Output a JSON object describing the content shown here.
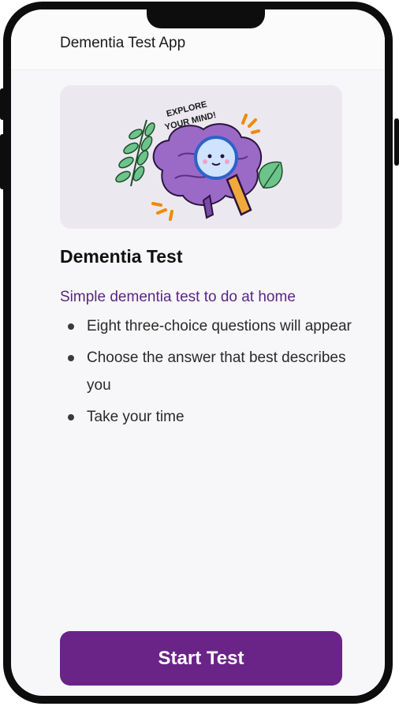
{
  "header": {
    "title": "Dementia Test App"
  },
  "banner": {
    "text_line1": "EXPLORE",
    "text_line2": "YOUR MIND!",
    "icon": "brain-magnifier-illustration"
  },
  "main": {
    "title": "Dementia Test",
    "subtitle": "Simple dementia test to do at home",
    "bullets": [
      "Eight three-choice questions will appear",
      "Choose the answer that best describes you",
      "Take your time"
    ]
  },
  "footer": {
    "start_label": "Start Test"
  },
  "colors": {
    "accent": "#6a2488",
    "subtitle": "#5b2585",
    "banner_bg": "#ece8f0"
  }
}
